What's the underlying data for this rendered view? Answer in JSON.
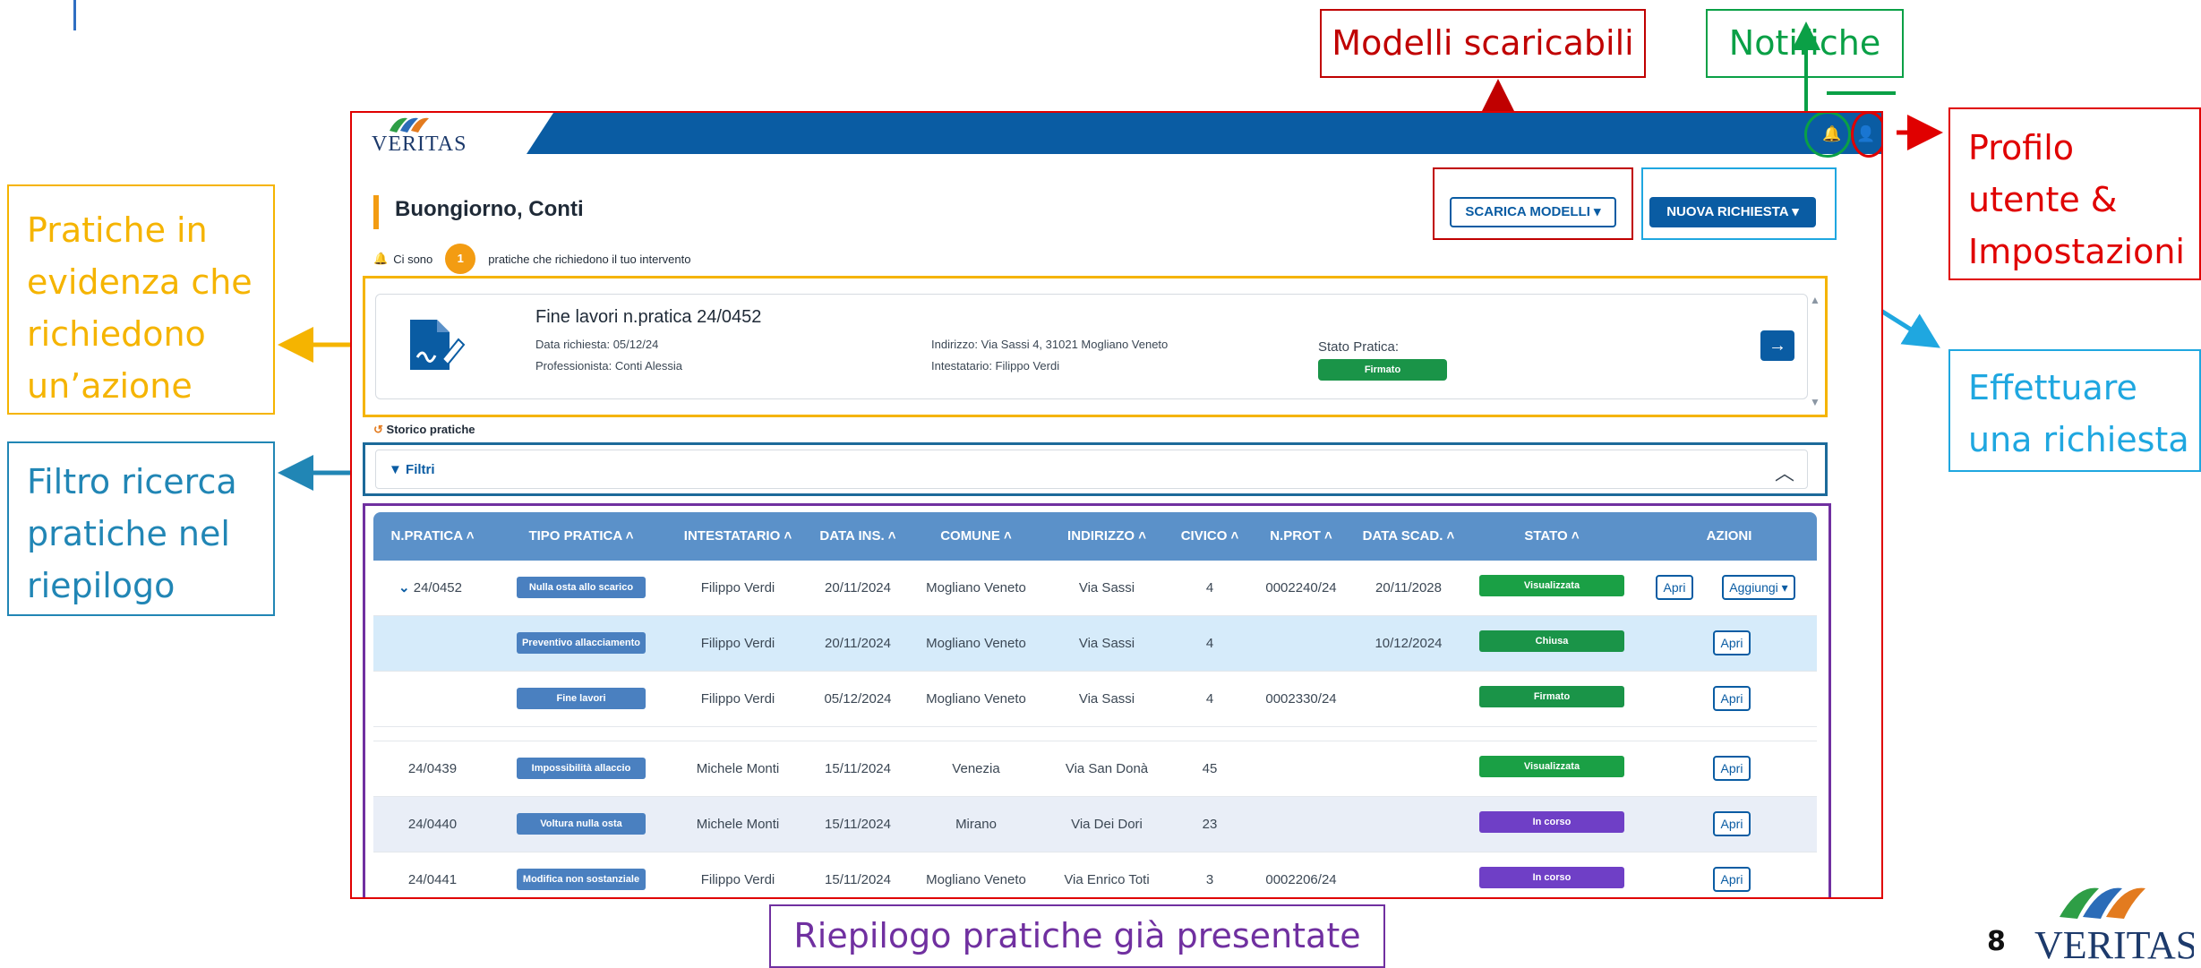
{
  "callouts": {
    "modelli": "Modelli scaricabili",
    "notifiche": "Notifiche",
    "profilo": [
      "Profilo",
      "utente &",
      "Impostazioni"
    ],
    "pratiche": [
      "Pratiche in",
      "evidenza che",
      "richiedono",
      "un’azione"
    ],
    "filtro": [
      "Filtro ricerca",
      "pratiche nel",
      "riepilogo"
    ],
    "effettuare": [
      "Effettuare",
      "una richiesta"
    ],
    "riepilogo": "Riepilogo pratiche già presentate"
  },
  "app": {
    "logo_text": "VERITAS",
    "greeting": "Buongiorno, Conti",
    "btn_scarica": "SCARICA MODELLI",
    "btn_nuova": "NUOVA RICHIESTA",
    "cisono_pre": "Ci sono",
    "cisono_count": "1",
    "cisono_post": "pratiche che richiedono il tuo intervento",
    "storico": "Storico pratiche",
    "filtri": "Filtri"
  },
  "card": {
    "title": "Fine lavori n.pratica 24/0452",
    "data_richiesta": "Data richiesta: 05/12/24",
    "professionista": "Professionista: Conti Alessia",
    "indirizzo": "Indirizzo: Via Sassi 4, 31021 Mogliano Veneto",
    "intestatario": "Intestatario: Filippo Verdi",
    "stato_label": "Stato Pratica:",
    "stato_value": "Firmato"
  },
  "table": {
    "headers": [
      "N.PRATICA",
      "TIPO PRATICA",
      "INTESTATARIO",
      "DATA INS.",
      "COMUNE",
      "INDIRIZZO",
      "CIVICO",
      "N.PROT",
      "DATA SCAD.",
      "STATO",
      "AZIONI"
    ],
    "rows": [
      {
        "npratica": "24/0452",
        "tipo": "Nulla osta allo scarico",
        "intestatario": "Filippo Verdi",
        "data_ins": "20/11/2024",
        "comune": "Mogliano Veneto",
        "indirizzo": "Via Sassi",
        "civico": "4",
        "nprot": "0002240/24",
        "data_scad": "20/11/2028",
        "stato": "Visualizzata",
        "apri": "Apri",
        "aggiungi": "Aggiungi"
      },
      {
        "npratica": "",
        "tipo": "Preventivo allacciamento",
        "intestatario": "Filippo Verdi",
        "data_ins": "20/11/2024",
        "comune": "Mogliano Veneto",
        "indirizzo": "Via Sassi",
        "civico": "4",
        "nprot": "",
        "data_scad": "10/12/2024",
        "stato": "Chiusa",
        "apri": "Apri"
      },
      {
        "npratica": "",
        "tipo": "Fine lavori",
        "intestatario": "Filippo Verdi",
        "data_ins": "05/12/2024",
        "comune": "Mogliano Veneto",
        "indirizzo": "Via Sassi",
        "civico": "4",
        "nprot": "0002330/24",
        "data_scad": "",
        "stato": "Firmato",
        "apri": "Apri"
      },
      {
        "npratica": "24/0439",
        "tipo": "Impossibilità allaccio",
        "intestatario": "Michele Monti",
        "data_ins": "15/11/2024",
        "comune": "Venezia",
        "indirizzo": "Via San Donà",
        "civico": "45",
        "nprot": "",
        "data_scad": "",
        "stato": "Visualizzata",
        "apri": "Apri"
      },
      {
        "npratica": "24/0440",
        "tipo": "Voltura nulla osta",
        "intestatario": "Michele Monti",
        "data_ins": "15/11/2024",
        "comune": "Mirano",
        "indirizzo": "Via Dei Dori",
        "civico": "23",
        "nprot": "",
        "data_scad": "",
        "stato": "In corso",
        "apri": "Apri"
      },
      {
        "npratica": "24/0441",
        "tipo": "Modifica non sostanziale",
        "intestatario": "Filippo Verdi",
        "data_ins": "15/11/2024",
        "comune": "Mogliano Veneto",
        "indirizzo": "Via Enrico Toti",
        "civico": "3",
        "nprot": "0002206/24",
        "data_scad": "",
        "stato": "In corso",
        "apri": "Apri"
      }
    ]
  },
  "colors": {
    "primary": "#0a5ca3",
    "stato_visualizzata": "#1aa045",
    "stato_chiusa": "#1a9448",
    "stato_firmato": "#1a9448",
    "stato_in_corso": "#6f3fc6",
    "highlight": "#f39c12"
  },
  "footer": {
    "page_number": "8",
    "brand": "VERITAS"
  }
}
